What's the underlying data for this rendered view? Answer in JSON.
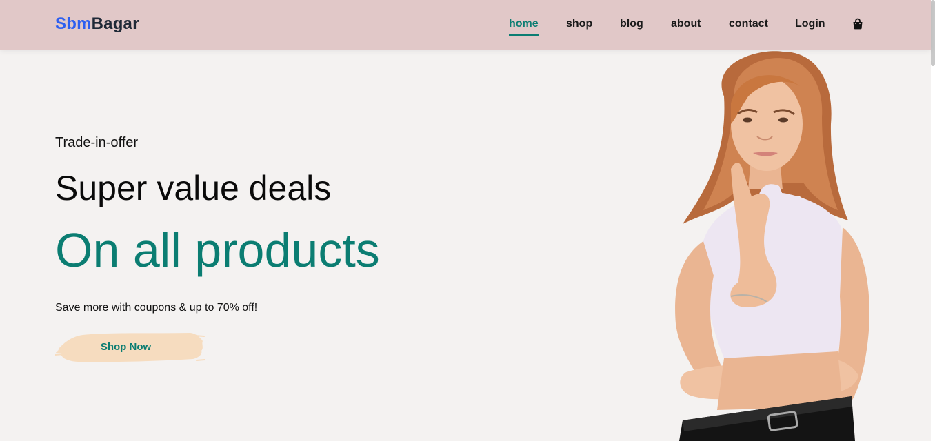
{
  "brand": {
    "prefix": "Sbm",
    "suffix": "Bagar"
  },
  "nav": {
    "items": [
      {
        "label": "home",
        "active": true
      },
      {
        "label": "shop",
        "active": false
      },
      {
        "label": "blog",
        "active": false
      },
      {
        "label": "about",
        "active": false
      },
      {
        "label": "contact",
        "active": false
      },
      {
        "label": "Login",
        "active": false
      }
    ],
    "cart_icon": "shopping-bag-icon"
  },
  "hero": {
    "kicker": "Trade-in-offer",
    "headline": "Super value deals",
    "headline_accent": "On all products",
    "subtext": "Save more with coupons & up to 70% off!",
    "cta_label": "Shop Now",
    "image": "woman-in-white-top-photo"
  },
  "colors": {
    "header_bg": "#e1c8c8",
    "page_bg": "#f4f2f1",
    "accent_teal": "#0b7d72",
    "logo_blue": "#2d5ff0",
    "cta_brush": "#f6dcbf"
  }
}
